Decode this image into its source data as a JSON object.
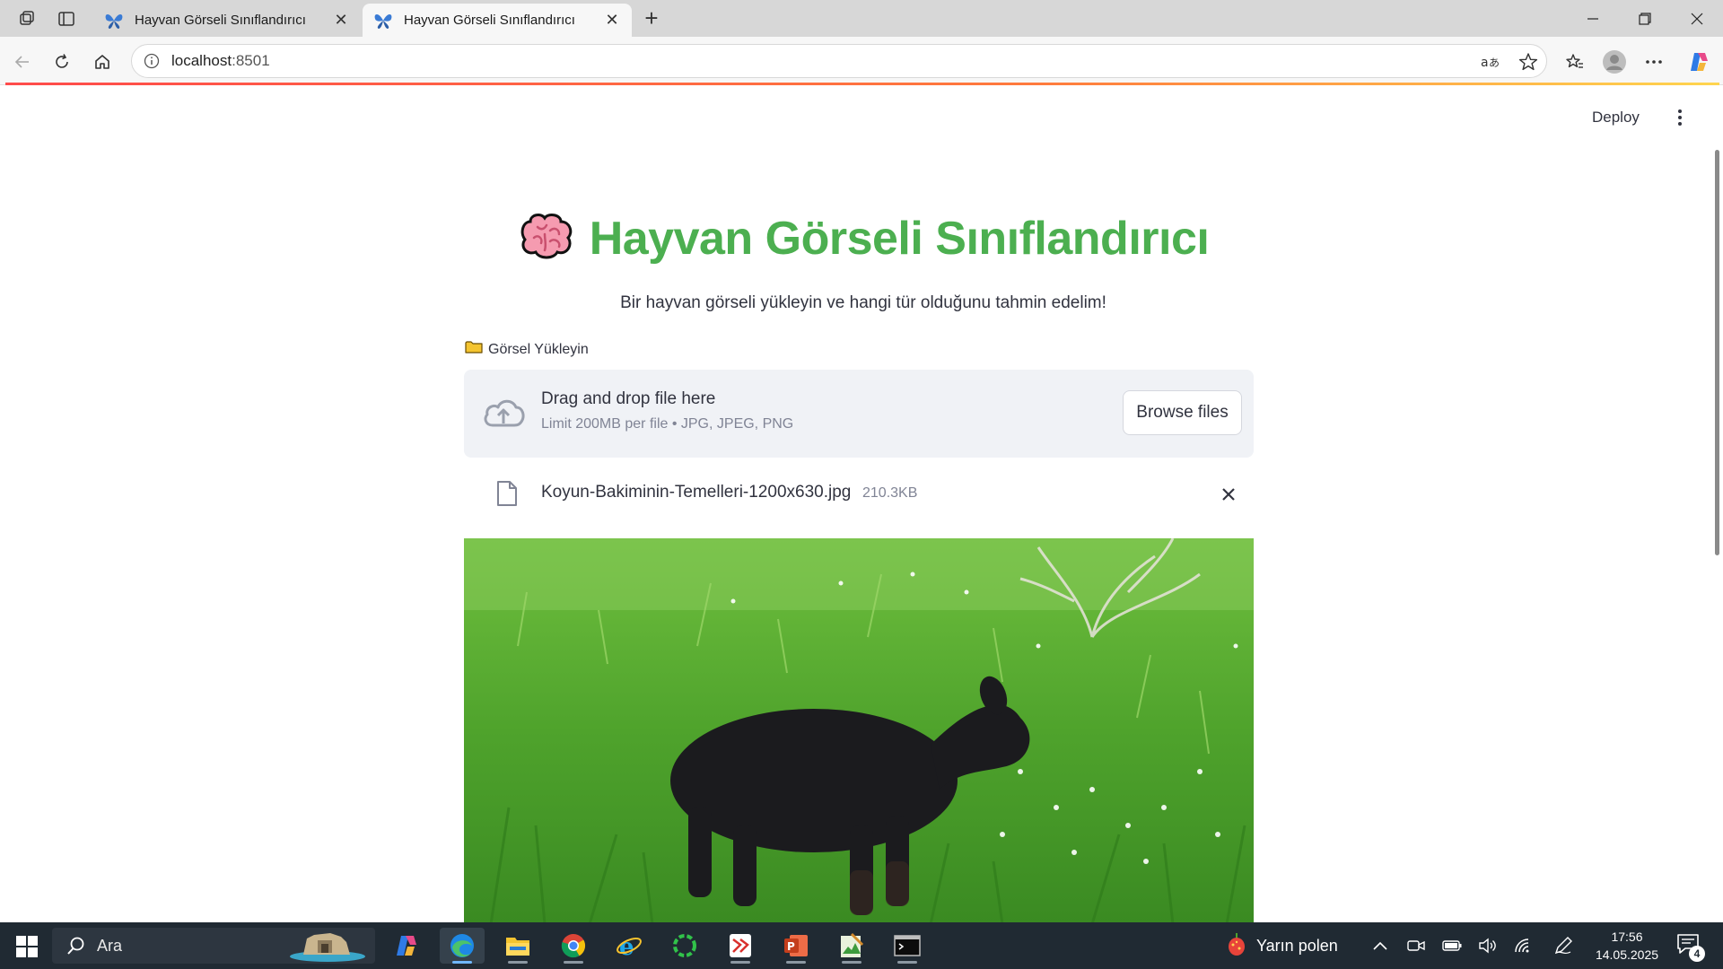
{
  "browser": {
    "tabs": [
      {
        "title": "Hayvan Görseli Sınıflandırıcı",
        "active": false
      },
      {
        "title": "Hayvan Görseli Sınıflandırıcı",
        "active": true
      }
    ],
    "url_host": "localhost",
    "url_port": ":8501"
  },
  "app": {
    "deploy_label": "Deploy",
    "title_icon": "brain-icon",
    "title": "Hayvan Görseli Sınıflandırıcı",
    "subtitle": "Bir hayvan görseli yükleyin ve hangi tür olduğunu tahmin edelim!",
    "uploader": {
      "label_icon": "folder-icon",
      "label": "Görsel Yükleyin",
      "drag_text": "Drag and drop file here",
      "limit_text": "Limit 200MB per file • JPG, JPEG, PNG",
      "browse_label": "Browse files"
    },
    "uploaded_file": {
      "name": "Koyun-Bakiminin-Temelleri-1200x630.jpg",
      "size": "210.3KB"
    },
    "preview_image": "black-lamb-on-grass-photo"
  },
  "taskbar": {
    "search_label": "Ara",
    "weather_label": "Yarın polen",
    "time": "17:56",
    "date": "14.05.2025",
    "notification_count": "4"
  },
  "colors": {
    "title_green": "#4caf50",
    "dropzone_bg": "#f0f2f6",
    "taskbar_bg": "#202a33"
  }
}
